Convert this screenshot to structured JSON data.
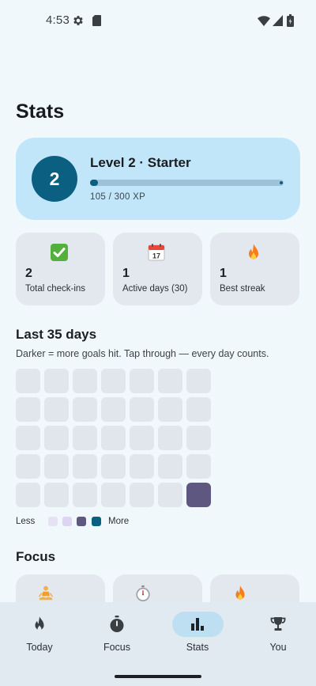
{
  "status_bar": {
    "time": "4:53",
    "icons": [
      "gear-icon",
      "sd-card-icon",
      "wifi-icon",
      "cell-signal-icon",
      "battery-icon"
    ]
  },
  "page": {
    "title": "Stats"
  },
  "level_card": {
    "badge": "2",
    "title": "Level 2 · Starter",
    "xp_text": "105 / 300 XP",
    "xp_current": 105,
    "xp_max": 300,
    "colors": {
      "card": "#c2e6f9",
      "badge": "#0b5f80",
      "track": "#9cc3d8"
    }
  },
  "stats": [
    {
      "icon": "check-mark-icon",
      "value": "2",
      "label": "Total check-ins"
    },
    {
      "icon": "calendar-icon",
      "value": "1",
      "label": "Active days (30)"
    },
    {
      "icon": "fire-icon",
      "value": "1",
      "label": "Best streak"
    }
  ],
  "heatmap": {
    "title": "Last 35 days",
    "subtitle": "Darker = more goals hit. Tap through — every day counts.",
    "rows": 5,
    "columns": 7,
    "levels": [
      0,
      0,
      0,
      0,
      0,
      0,
      0,
      0,
      0,
      0,
      0,
      0,
      0,
      0,
      0,
      0,
      0,
      0,
      0,
      0,
      0,
      0,
      0,
      0,
      0,
      0,
      0,
      0,
      0,
      0,
      0,
      0,
      0,
      0,
      3
    ],
    "level_colors": [
      "#e0e6ec",
      "#e6e2f4",
      "#dcd4f0",
      "#5e5880",
      "#0b5f80"
    ],
    "legend": {
      "less_label": "Less",
      "more_label": "More",
      "swatches": [
        "#e6e2f4",
        "#dcd4f0",
        "#5e5880",
        "#0b5f80"
      ]
    }
  },
  "focus": {
    "title": "Focus",
    "cards": [
      {
        "icon": "meditation-icon"
      },
      {
        "icon": "stopwatch-icon"
      },
      {
        "icon": "fire-icon"
      }
    ]
  },
  "bottom_nav": {
    "active_index": 2,
    "items": [
      {
        "icon": "flame-icon",
        "label": "Today"
      },
      {
        "icon": "timer-icon",
        "label": "Focus"
      },
      {
        "icon": "bar-chart-icon",
        "label": "Stats"
      },
      {
        "icon": "trophy-icon",
        "label": "You"
      }
    ]
  }
}
